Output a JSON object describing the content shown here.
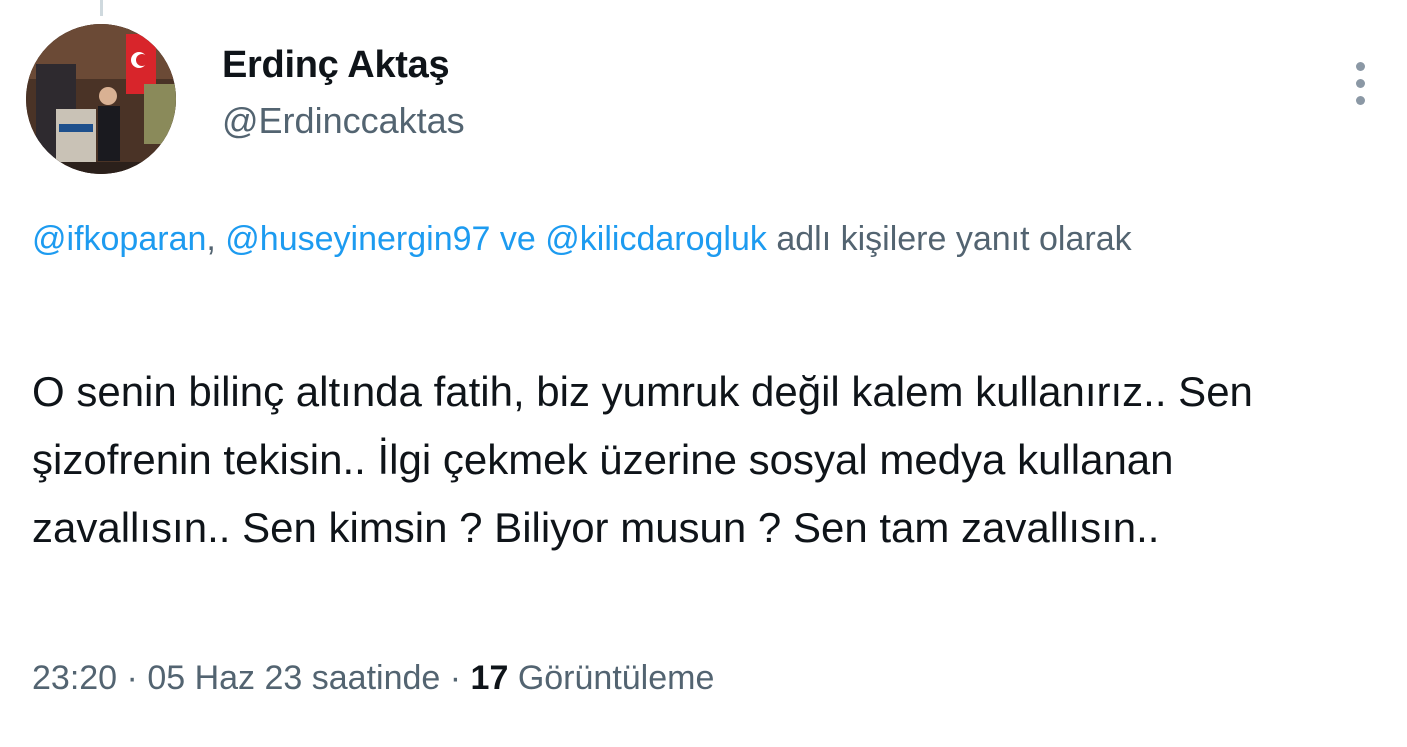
{
  "author": {
    "name": "Erdinç Aktaş",
    "handle": "@Erdinccaktas",
    "avatar_icon": "profile-photo"
  },
  "reply": {
    "mentions": [
      "@ifkoparan",
      "@huseyinergin97",
      "@kilicdarogluk"
    ],
    "separator": ",",
    "conjunction": "ve",
    "suffix": "adlı kişilere yanıt olarak"
  },
  "tweet": {
    "text": "O senin bilinç altında fatih, biz yumruk değil kalem kullanırız.. Sen şizofrenin tekisin.. İlgi çekmek üzerine sosyal medya kullanan zavallısın.. Sen kimsin ? Biliyor musun ? Sen tam zavallısın.."
  },
  "meta": {
    "time": "23:20",
    "dot": "·",
    "date_text": "05 Haz 23 saatinde",
    "views_count": "17",
    "views_label": "Görüntüleme"
  },
  "colors": {
    "link": "#1d9bf0",
    "secondary_text": "#536471",
    "primary_text": "#0f1419"
  },
  "icons": {
    "more_menu": "more-vertical-icon"
  }
}
